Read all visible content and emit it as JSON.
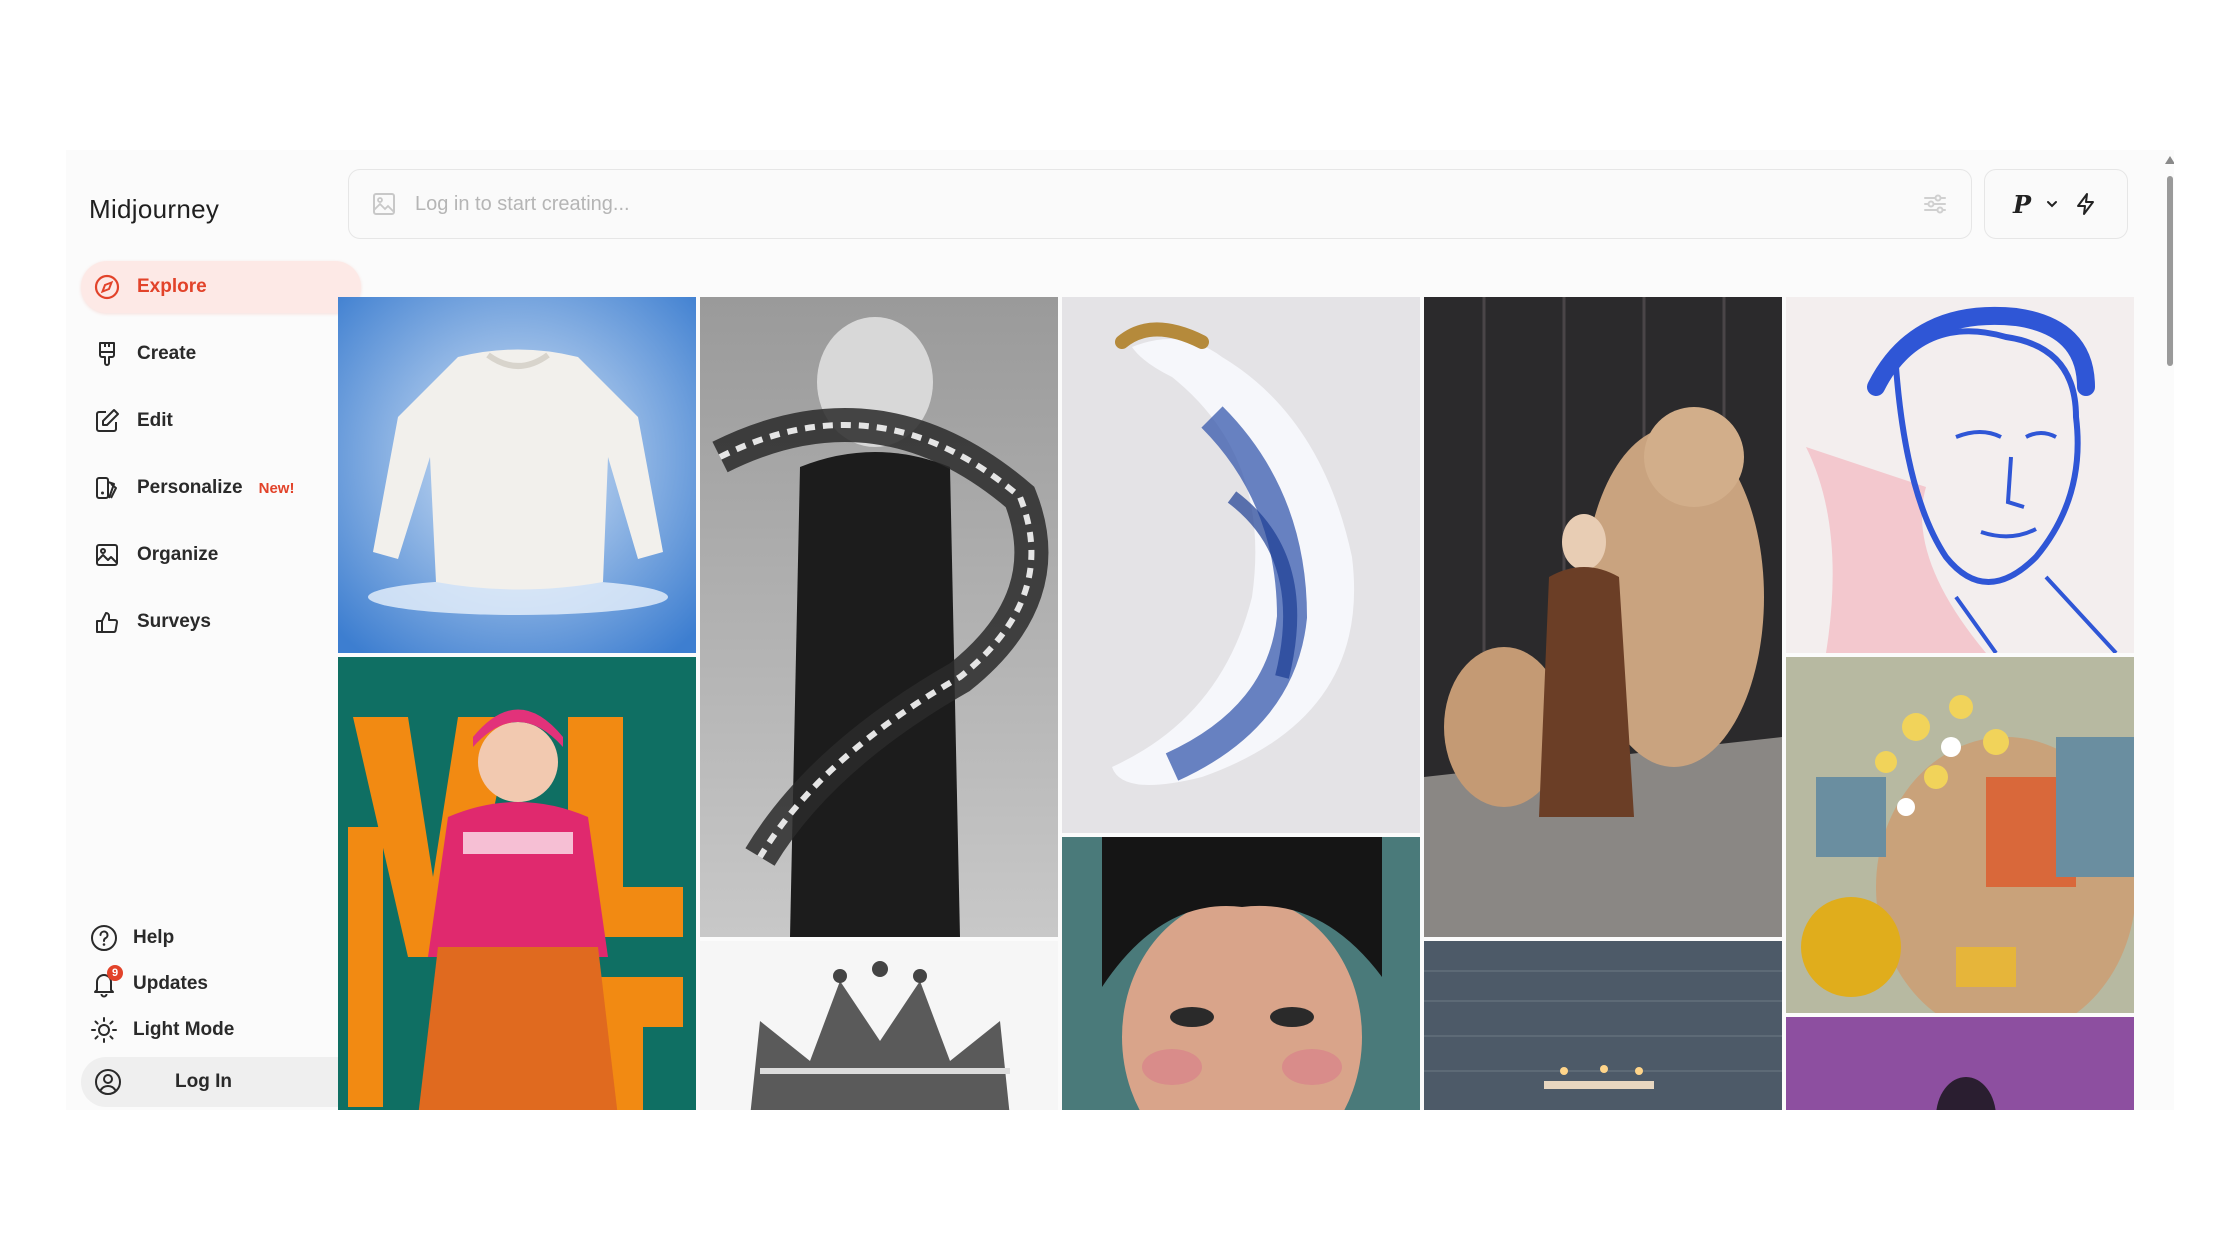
{
  "brand": "Midjourney",
  "nav": [
    {
      "label": "Explore",
      "icon": "compass-icon",
      "active": true
    },
    {
      "label": "Create",
      "icon": "brush-icon"
    },
    {
      "label": "Edit",
      "icon": "edit-icon"
    },
    {
      "label": "Personalize",
      "icon": "personalize-icon",
      "badge": "New!"
    },
    {
      "label": "Organize",
      "icon": "image-folder-icon"
    },
    {
      "label": "Surveys",
      "icon": "thumbs-up-icon"
    }
  ],
  "bottom_nav": [
    {
      "label": "Help",
      "icon": "help-icon"
    },
    {
      "label": "Updates",
      "icon": "bell-icon",
      "count": "9"
    },
    {
      "label": "Light Mode",
      "icon": "sun-icon"
    }
  ],
  "login": {
    "label": "Log In",
    "icon": "user-circle-icon"
  },
  "prompt": {
    "placeholder": "Log in to start creating..."
  },
  "mode": {
    "label": "P"
  },
  "colors": {
    "accent": "#e2432a",
    "accent_bg": "#fde9e6"
  },
  "gallery": [
    {
      "name": "white-sweater-image"
    },
    {
      "name": "typography-portrait-image"
    },
    {
      "name": "porcelain-banana-image"
    },
    {
      "name": "poodle-fashion-image"
    },
    {
      "name": "sketch-portrait-image"
    },
    {
      "name": "anime-poster-image"
    },
    {
      "name": "crown-engraving-image"
    },
    {
      "name": "freckled-portrait-image"
    },
    {
      "name": "sea-dinner-image"
    },
    {
      "name": "flower-collage-image"
    },
    {
      "name": "purple-portrait-image"
    }
  ]
}
